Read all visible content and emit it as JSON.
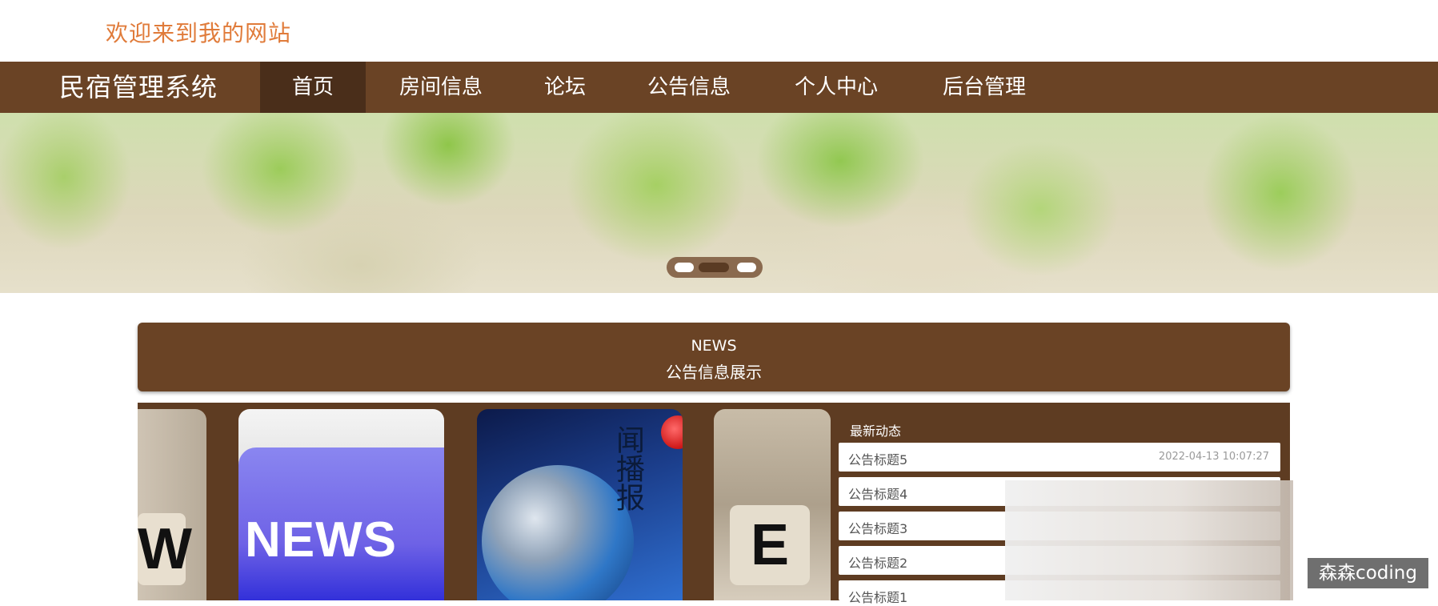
{
  "header": {
    "welcome_text": "欢迎来到我的网站"
  },
  "navbar": {
    "brand": "民宿管理系统",
    "items": [
      {
        "label": "首页",
        "active": true
      },
      {
        "label": "房间信息",
        "active": false
      },
      {
        "label": "论坛",
        "active": false
      },
      {
        "label": "公告信息",
        "active": false
      },
      {
        "label": "个人中心",
        "active": false
      },
      {
        "label": "后台管理",
        "active": false
      }
    ]
  },
  "banner": {
    "slide_count": 3,
    "active_slide": 2
  },
  "news_section": {
    "title_en": "NEWS",
    "title_cn": "公告信息展示",
    "cards": [
      {
        "image_text": "W"
      },
      {
        "image_text": "NEWS"
      },
      {
        "image_text": "闻播报"
      },
      {
        "image_text": "E"
      }
    ],
    "latest": {
      "title": "最新动态",
      "items": [
        {
          "title": "公告标题5",
          "date": "2022-04-13 10:07:27"
        },
        {
          "title": "公告标题4",
          "date": ""
        },
        {
          "title": "公告标题3",
          "date": ""
        },
        {
          "title": "公告标题2",
          "date": ""
        },
        {
          "title": "公告标题1",
          "date": ""
        }
      ]
    }
  },
  "watermark": {
    "text": "森森coding"
  },
  "colors": {
    "nav_bg": "#6a4325",
    "nav_active": "#4a2e1a",
    "welcome": "#e07b3a",
    "section_bg": "#5e3c22"
  }
}
